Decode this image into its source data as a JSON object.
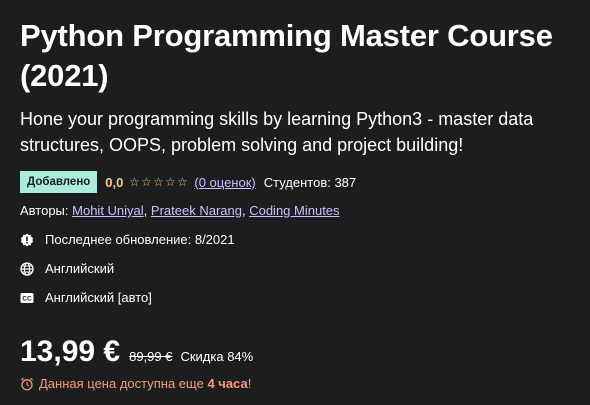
{
  "course": {
    "title": "Python Programming Master Course (2021)",
    "subtitle": "Hone your programming skills by learning Python3 - master data structures, OOPS, problem solving and project building!",
    "badge": "Добавлено",
    "rating": "0,0",
    "stars": [
      "☆",
      "☆",
      "☆",
      "☆",
      "☆"
    ],
    "ratings_count": "(0 оценок)",
    "students": "Студентов: 387",
    "authors_label": "Авторы:",
    "authors": [
      "Mohit Uniyal",
      "Prateek Narang",
      "Coding Minutes"
    ],
    "updated": "Последнее обновление: 8/2021",
    "language": "Английский",
    "captions": "Английский [авто]"
  },
  "pricing": {
    "price": "13,99 €",
    "old_price": "89,99 €",
    "discount": "Скидка 84%",
    "timer_prefix": "Данная цена доступна еще",
    "timer_bold": "4 часа",
    "timer_suffix": "!"
  },
  "colors": {
    "background": "#1c1d1f",
    "badge_bg": "#aceadb",
    "rating": "#f3ca8c",
    "link": "#cec0fc",
    "timer": "#f69c79"
  },
  "icons": [
    "alert-badge-icon",
    "globe-icon",
    "closed-captions-icon",
    "alarm-clock-icon",
    "star-icon"
  ]
}
